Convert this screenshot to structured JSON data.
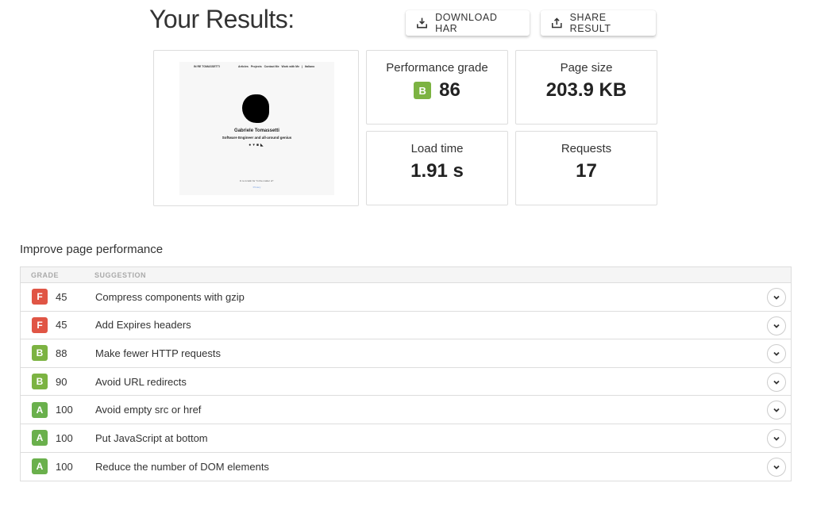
{
  "header": {
    "title": "Your Results:",
    "download_label": "DOWNLOAD HAR",
    "share_label": "SHARE RESULT"
  },
  "thumbnail": {
    "brand": "IN RE TOMASSETTI",
    "nav": [
      "Articles",
      "Projects",
      "Contact Me",
      "Work with Me",
      "|",
      "Italiano"
    ],
    "name": "Gabriele Tomassetti",
    "subtitle": "Software Engineer and all-around genius",
    "socials": [
      "github-icon",
      "twitter-icon",
      "linkedin-icon",
      "rss-icon"
    ],
    "footer": "In re is latin for \"in the matter of\".",
    "privacy": "Privacy"
  },
  "stats": {
    "performance": {
      "label": "Performance grade",
      "grade": "B",
      "grade_color": "#7cb342",
      "value": "86"
    },
    "page_size": {
      "label": "Page size",
      "value": "203.9 KB"
    },
    "load_time": {
      "label": "Load time",
      "value": "1.91 s"
    },
    "requests": {
      "label": "Requests",
      "value": "17"
    }
  },
  "improve": {
    "title": "Improve page performance",
    "columns": {
      "grade": "GRADE",
      "suggestion": "SUGGESTION"
    },
    "rows": [
      {
        "grade": "F",
        "color": "#e05545",
        "score": "45",
        "text": "Compress components with gzip"
      },
      {
        "grade": "F",
        "color": "#e05545",
        "score": "45",
        "text": "Add Expires headers"
      },
      {
        "grade": "B",
        "color": "#7cb342",
        "score": "88",
        "text": "Make fewer HTTP requests"
      },
      {
        "grade": "B",
        "color": "#7cb342",
        "score": "90",
        "text": "Avoid URL redirects"
      },
      {
        "grade": "A",
        "color": "#6ab04c",
        "score": "100",
        "text": "Avoid empty src or href"
      },
      {
        "grade": "A",
        "color": "#6ab04c",
        "score": "100",
        "text": "Put JavaScript at bottom"
      },
      {
        "grade": "A",
        "color": "#6ab04c",
        "score": "100",
        "text": "Reduce the number of DOM elements"
      }
    ]
  }
}
